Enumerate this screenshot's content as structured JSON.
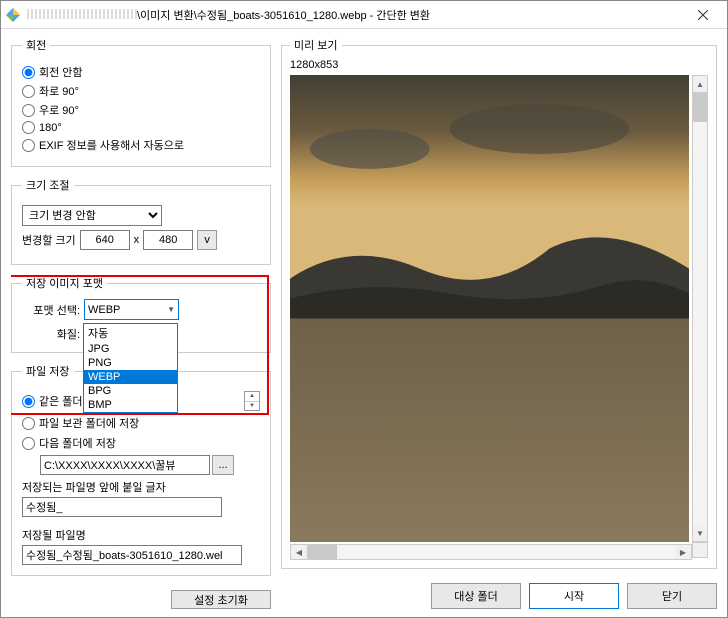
{
  "window": {
    "title_prefix": " ",
    "title_path": "\\이미지 변환\\수정됨_boats-3051610_1280.webp",
    "title_suffix": " - 간단한 변환"
  },
  "rotation": {
    "legend": "회전",
    "opt_none": "회전 안함",
    "opt_left90": "좌로 90°",
    "opt_right90": "우로 90°",
    "opt_180": "180°",
    "opt_exif": "EXIF 정보를 사용해서 자동으로"
  },
  "resize": {
    "legend": "크기 조절",
    "combo_value": "크기 변경 안함",
    "label_change": "변경할 크기",
    "w": "640",
    "h": "480",
    "x": "x",
    "v": "v"
  },
  "format": {
    "legend": "저장 이미지 포맷",
    "label_format": "포맷 선택:",
    "label_quality": "화질:",
    "selected": "WEBP",
    "options": [
      "자동",
      "JPG",
      "PNG",
      "WEBP",
      "BPG",
      "BMP"
    ]
  },
  "filesave": {
    "legend": "파일 저장",
    "opt_same": "같은 폴더에",
    "opt_view": "파일 보관 폴더에 저장",
    "opt_other": "다음 폴더에 저장",
    "path_value": "C:\\XXXX\\XXXX\\XXXX\\꿀뷰",
    "dots": "...",
    "label_prefix": "저장되는 파일명 앞에 붙일 글자",
    "prefix_value": "수정됨_",
    "label_outname": "저장될 파일명",
    "outname_value": "수정됨_수정됨_boats-3051610_1280.wel"
  },
  "buttons": {
    "reset": "설정 초기화",
    "dest_folder": "대상 폴더",
    "start": "시작",
    "close": "닫기"
  },
  "preview": {
    "legend": "미리 보기",
    "dims": "1280x853"
  }
}
